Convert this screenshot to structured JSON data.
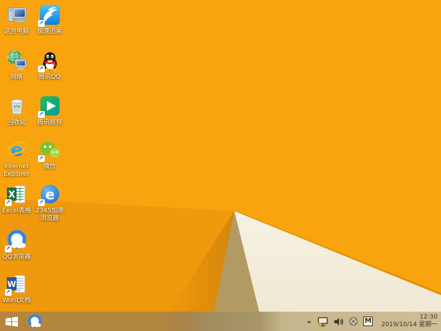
{
  "desktop": {
    "icons": [
      {
        "name": "this-pc",
        "label": "这台电脑",
        "shortcut": false
      },
      {
        "name": "thunder",
        "label": "极速迅雷",
        "shortcut": true
      },
      {
        "name": "network",
        "label": "网络",
        "shortcut": false
      },
      {
        "name": "tencent-qq",
        "label": "腾讯QQ",
        "shortcut": true
      },
      {
        "name": "recycle-bin",
        "label": "回收站",
        "shortcut": false
      },
      {
        "name": "tencent-video",
        "label": "腾讯视频",
        "shortcut": true
      },
      {
        "name": "internet-explorer",
        "label": "Internet Explorer",
        "shortcut": false
      },
      {
        "name": "wechat",
        "label": "微信",
        "shortcut": true
      },
      {
        "name": "excel",
        "label": "Excel表格",
        "shortcut": true
      },
      {
        "name": "browser2345",
        "label": "2345加速浏览器",
        "shortcut": true
      },
      {
        "name": "qq-browser",
        "label": "QQ浏览器",
        "shortcut": true
      },
      {
        "name": "word",
        "label": "Word文档",
        "shortcut": true
      }
    ],
    "glyphs": {
      "excel": "X",
      "word": "W",
      "internet_explorer": "e",
      "browser2345": "e"
    }
  },
  "taskbar": {
    "pinned": [
      {
        "name": "qq-browser"
      }
    ],
    "tray": {
      "ime": "M",
      "time": "12:30",
      "date": "2019/10/14 星期一"
    }
  },
  "colors": {
    "wallpaper_base": "#f9a40e",
    "wallpaper_shade": "#f0990c",
    "facet_white": "#f3edda",
    "facet_tan": "#b29a63",
    "ridge": "#e28d00",
    "taskbar_left": "#b3863f",
    "taskbar_right": "#cfbd96",
    "icon_label_text": "#ffffff",
    "clock_text": "#3e362a"
  }
}
